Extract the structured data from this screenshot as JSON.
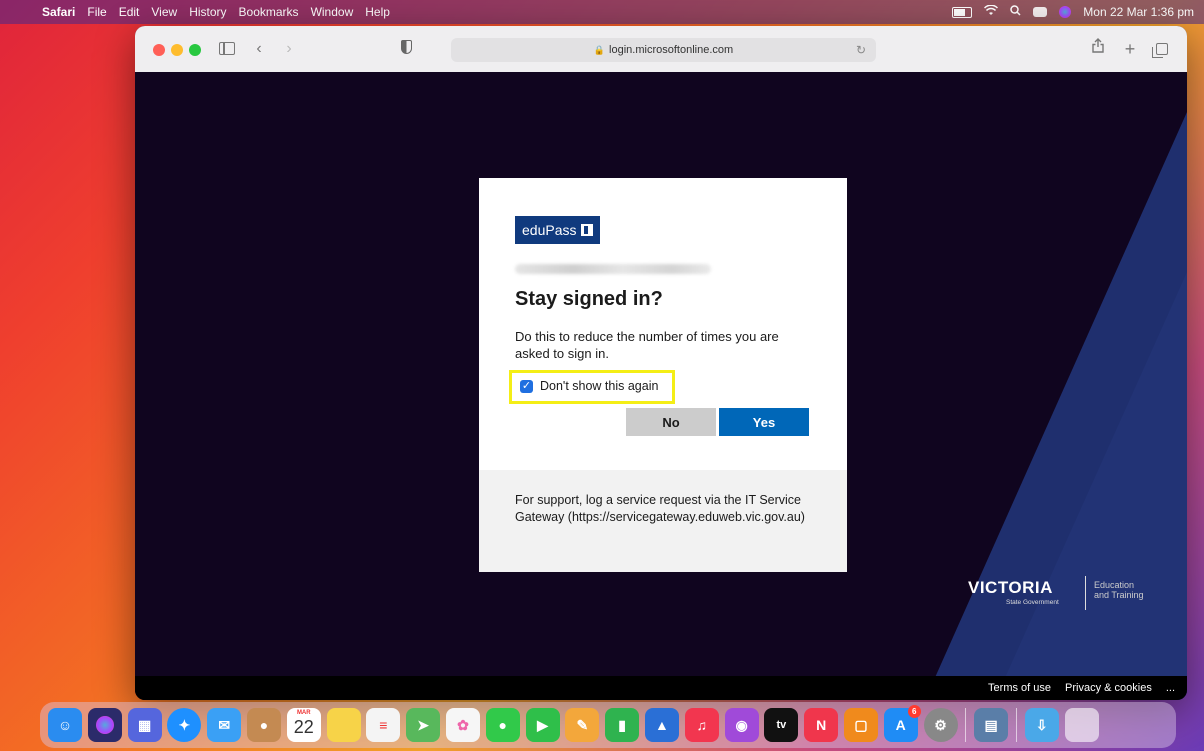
{
  "menubar": {
    "app_name": "Safari",
    "items": [
      "File",
      "Edit",
      "View",
      "History",
      "Bookmarks",
      "Window",
      "Help"
    ],
    "datetime": "Mon 22 Mar  1:36 pm"
  },
  "browser": {
    "url": "login.microsoftonline.com"
  },
  "dialog": {
    "logo_text": "eduPass",
    "title": "Stay signed in?",
    "description": "Do this to reduce the number of times you are asked to sign in.",
    "checkbox_label": "Don't show this again",
    "checkbox_checked": true,
    "no_label": "No",
    "yes_label": "Yes",
    "support_text": "For support, log a service request via the IT Service Gateway (https://servicegateway.eduweb.vic.gov.au)"
  },
  "branding": {
    "victoria": "VICTORIA",
    "state_government": "State Government",
    "department": "Education and Training"
  },
  "footer": {
    "terms": "Terms of use",
    "privacy": "Privacy & cookies",
    "more": "..."
  },
  "dock": {
    "calendar_month": "MAR",
    "calendar_day": "22",
    "appstore_badge": "6",
    "apps": [
      {
        "name": "finder",
        "color": "#2a8cf0"
      },
      {
        "name": "siri",
        "color": "#2b2b6a"
      },
      {
        "name": "launchpad",
        "color": "#5566dd"
      },
      {
        "name": "safari",
        "color": "#1e90ff"
      },
      {
        "name": "mail",
        "color": "#3aa0f5"
      },
      {
        "name": "contacts",
        "color": "#c48a52"
      },
      {
        "name": "calendar",
        "color": "#ffffff"
      },
      {
        "name": "notes",
        "color": "#f7d348"
      },
      {
        "name": "reminders",
        "color": "#f4f4f4"
      },
      {
        "name": "maps",
        "color": "#58b85c"
      },
      {
        "name": "photos",
        "color": "#f6f6f6"
      },
      {
        "name": "messages",
        "color": "#31c94a"
      },
      {
        "name": "facetime",
        "color": "#2fbf4a"
      },
      {
        "name": "pages",
        "color": "#f3a73b"
      },
      {
        "name": "numbers",
        "color": "#2fb34f"
      },
      {
        "name": "keynote",
        "color": "#2a6fd6"
      },
      {
        "name": "music",
        "color": "#f2364f"
      },
      {
        "name": "podcasts",
        "color": "#a04ad9"
      },
      {
        "name": "tv",
        "color": "#111111"
      },
      {
        "name": "news",
        "color": "#f0364c"
      },
      {
        "name": "books",
        "color": "#f08a1c"
      },
      {
        "name": "app-store",
        "color": "#1f8cf5"
      },
      {
        "name": "system-preferences",
        "color": "#888888"
      }
    ]
  },
  "colors": {
    "primary_button": "#0067b8",
    "secondary_button": "#cccccc",
    "highlight": "#f4ee16",
    "edupass_brand": "#103a7e"
  }
}
